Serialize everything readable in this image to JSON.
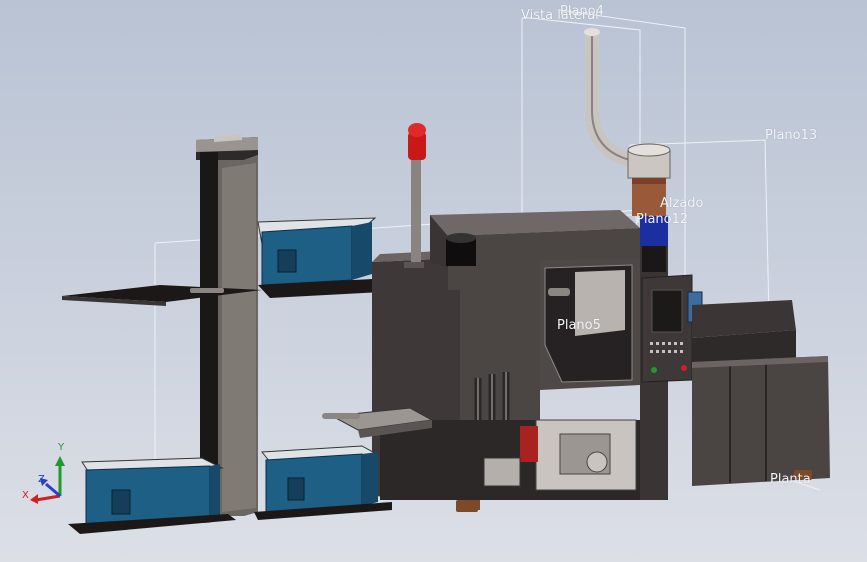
{
  "viewport": {
    "title": "",
    "background_top": "#b9c3d4",
    "background_bottom": "#dcdfe6"
  },
  "plane_labels": {
    "vista_lateral": "Vista lateral",
    "plano4": "Plano4",
    "plano13": "Plano13",
    "alzado": "Alzado",
    "plano12": "Plano12",
    "plano5": "Plano5",
    "planta": "Planta"
  },
  "triad": {
    "x": "X",
    "y": "Y",
    "z": "Z",
    "x_color": "#d0201f",
    "y_color": "#1f9a2c",
    "z_color": "#2a40c8"
  },
  "model": {
    "machine_color": "#4b4544",
    "bin_color": "#1e5f86",
    "beacon_color": "#c81818",
    "hopper_color": "#9a5a3a"
  }
}
